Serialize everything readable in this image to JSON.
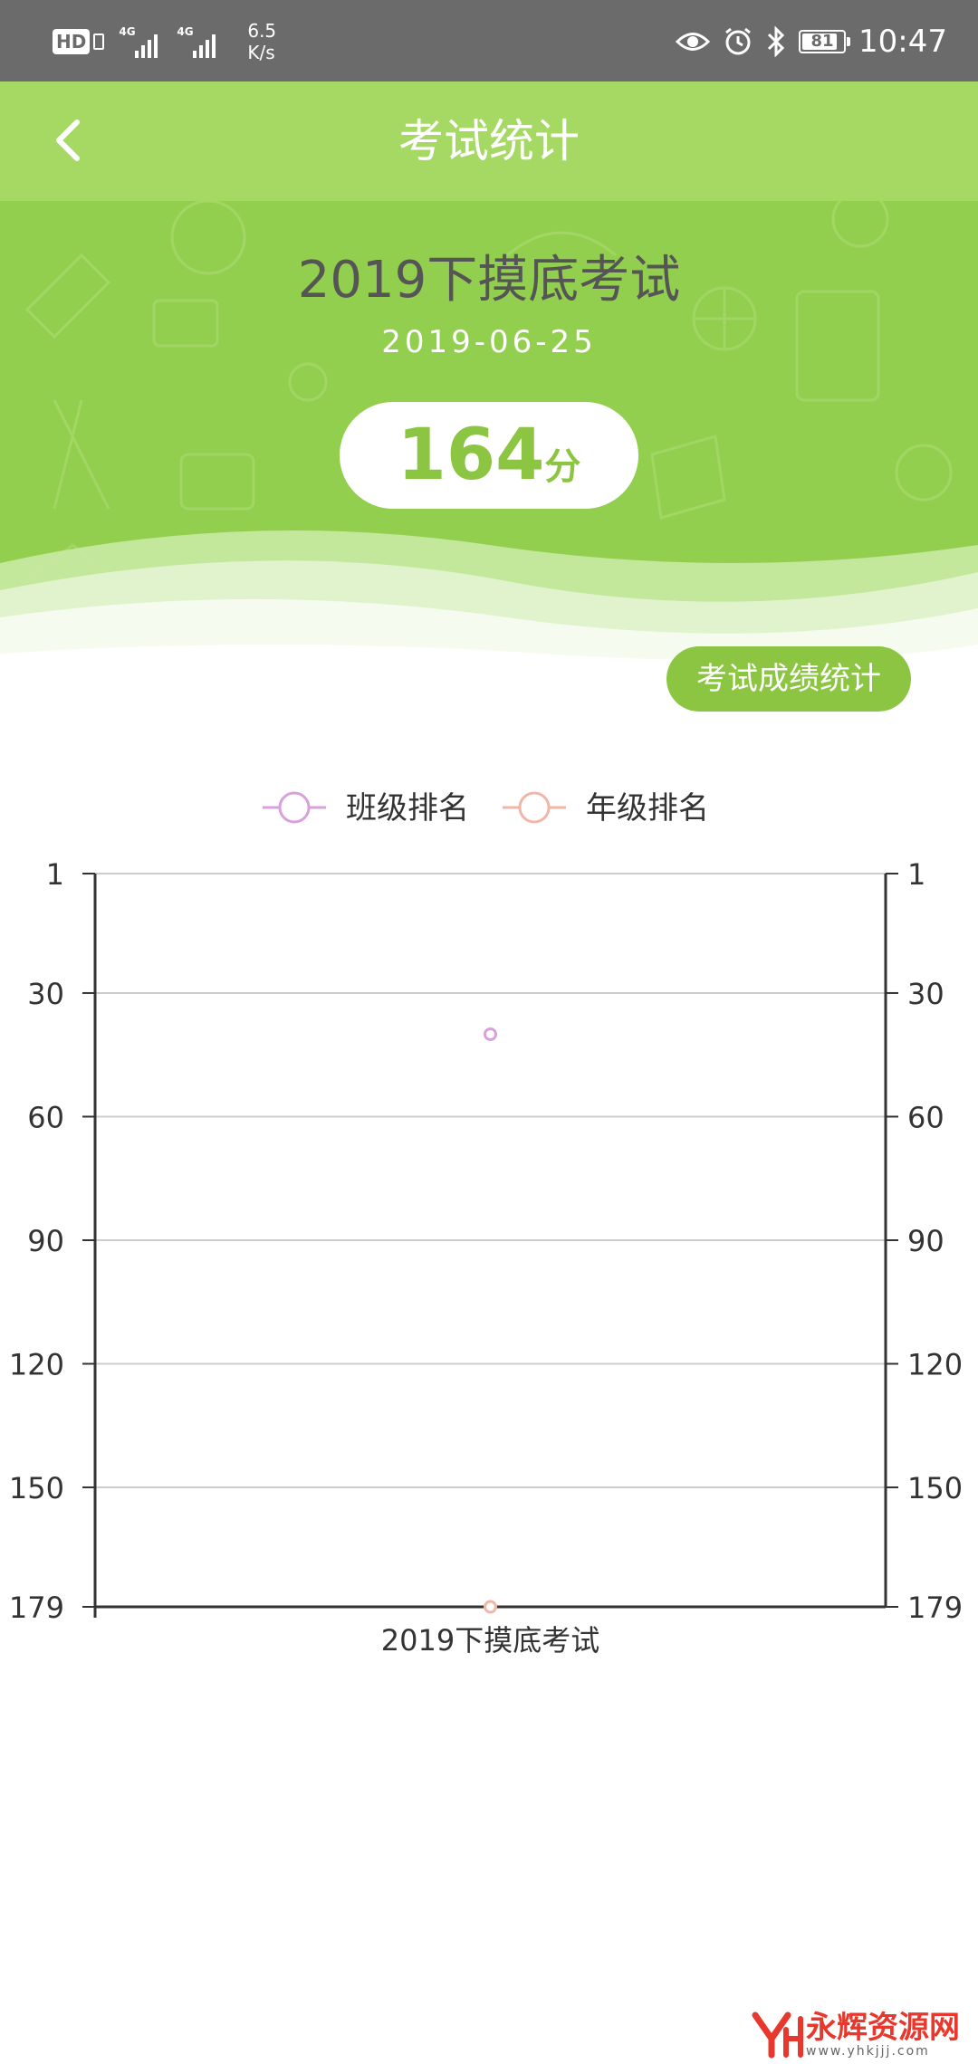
{
  "status_bar": {
    "hd_label": "HD",
    "network1": "4G",
    "network2": "4G",
    "speed_value": "6.5",
    "speed_unit": "K/s",
    "battery": "81",
    "time": "10:47",
    "icons": [
      "eye-icon",
      "alarm-icon",
      "bluetooth-icon"
    ]
  },
  "app_bar": {
    "title": "考试统计",
    "back_icon": "chevron-left-icon"
  },
  "exam": {
    "name": "2019下摸底考试",
    "date": "2019-06-25",
    "score": "164",
    "score_unit": "分"
  },
  "stats_button": "考试成绩统计",
  "colors": {
    "primary_green": "#8cc542",
    "app_bar_green": "#a6d964",
    "class_rank": "#d9a0dc",
    "grade_rank": "#f2b6a8"
  },
  "chart_data": {
    "type": "line",
    "categories": [
      "2019下摸底考试"
    ],
    "series": [
      {
        "name": "班级排名",
        "values": [
          40
        ]
      },
      {
        "name": "年级排名",
        "values": [
          179
        ]
      }
    ],
    "y_ticks": [
      1,
      30,
      60,
      90,
      120,
      150,
      179
    ],
    "ylim": [
      1,
      179
    ],
    "y_inverted": true,
    "dual_y_axis": true,
    "grid": true,
    "legend_position": "top"
  },
  "watermark": {
    "text": "永辉资源网",
    "url": "www.yhkjjj.com"
  }
}
